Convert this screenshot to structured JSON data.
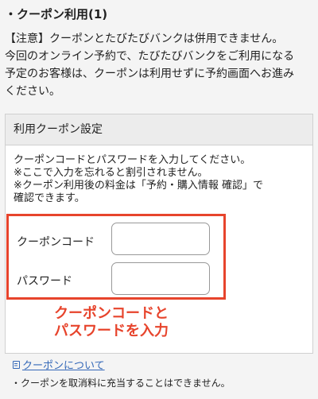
{
  "section": {
    "title": "・クーポン利用(1)"
  },
  "notice": {
    "lines": [
      "【注意】クーポンとたびたびバンクは併用できません。",
      "今回のオンライン予約で、たびたびバンクをご利用になる",
      "予定のお客様は、クーポンは利用せずに予約画面へお進み",
      "ください。"
    ]
  },
  "coupon_box": {
    "header": "利用クーポン設定",
    "instructions": [
      "クーポンコードとパスワードを入力してください。",
      "※ここで入力を忘れると割引されません。",
      "※クーポン利用後の料金は「予約・購入情報 確認」で",
      "確認できます。"
    ],
    "fields": {
      "code_label": "クーポンコード",
      "code_value": "",
      "password_label": "パスワード",
      "password_value": ""
    },
    "annotation": [
      "クーポンコードと",
      "パスワードを入力"
    ],
    "highlight_color": "#e7442c"
  },
  "footer": {
    "about_link": "クーポンについて",
    "about_icon": "document-icon",
    "note": "・クーポンを取消料に充当することはできません。"
  }
}
